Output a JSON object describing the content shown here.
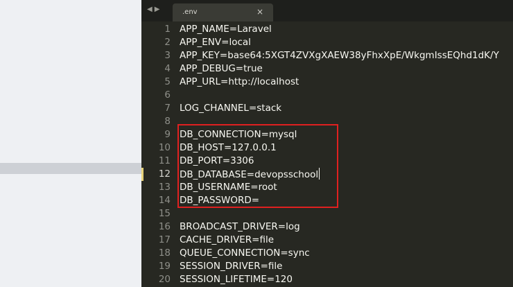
{
  "tabs": [
    {
      "label": ".env",
      "close_icon": "close-icon"
    }
  ],
  "nav": {
    "back_icon": "◀",
    "forward_icon": "▶"
  },
  "colors": {
    "editor_background": "#272822",
    "highlight_border": "#e02020",
    "active_line_marker": "#e7d27a"
  },
  "active_line": 12,
  "lines": [
    {
      "num": "1",
      "text": "APP_NAME=Laravel"
    },
    {
      "num": "2",
      "text": "APP_ENV=local"
    },
    {
      "num": "3",
      "text": "APP_KEY=base64:5XGT4ZVXgXAEW38yFhxXpE/WkgmIssEQhd1dK/Y"
    },
    {
      "num": "4",
      "text": "APP_DEBUG=true"
    },
    {
      "num": "5",
      "text": "APP_URL=http://localhost"
    },
    {
      "num": "6",
      "text": ""
    },
    {
      "num": "7",
      "text": "LOG_CHANNEL=stack"
    },
    {
      "num": "8",
      "text": ""
    },
    {
      "num": "9",
      "text": "DB_CONNECTION=mysql"
    },
    {
      "num": "10",
      "text": "DB_HOST=127.0.0.1"
    },
    {
      "num": "11",
      "text": "DB_PORT=3306"
    },
    {
      "num": "12",
      "text": "DB_DATABASE=devopsschool"
    },
    {
      "num": "13",
      "text": "DB_USERNAME=root"
    },
    {
      "num": "14",
      "text": "DB_PASSWORD="
    },
    {
      "num": "15",
      "text": ""
    },
    {
      "num": "16",
      "text": "BROADCAST_DRIVER=log"
    },
    {
      "num": "17",
      "text": "CACHE_DRIVER=file"
    },
    {
      "num": "18",
      "text": "QUEUE_CONNECTION=sync"
    },
    {
      "num": "19",
      "text": "SESSION_DRIVER=file"
    },
    {
      "num": "20",
      "text": "SESSION_LIFETIME=120"
    }
  ]
}
